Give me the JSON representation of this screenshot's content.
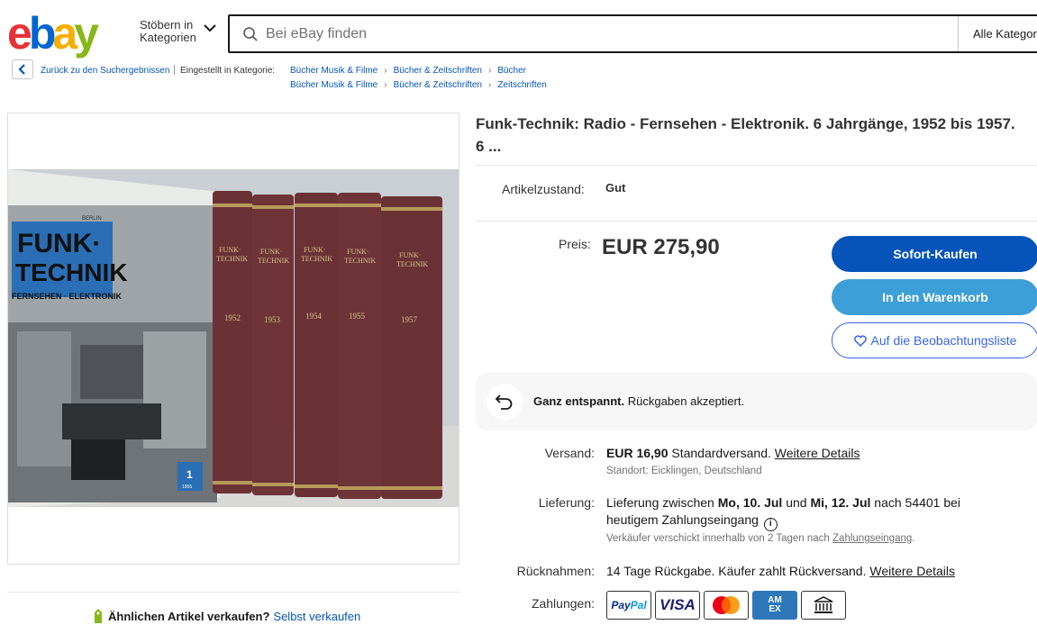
{
  "header": {
    "logo_letters": [
      "e",
      "b",
      "a",
      "y"
    ],
    "shop_by_category_line1": "Stöbern in",
    "shop_by_category_line2": "Kategorien",
    "search_placeholder": "Bei eBay finden",
    "category_select": "Alle Kategorien"
  },
  "breadcrumb": {
    "back_label": "Zurück zu den Suchergebnissen",
    "listed_in": "Eingestellt in Kategorie:",
    "path1": [
      "Bücher Musik & Filme",
      "Bücher & Zeitschriften",
      "Bücher"
    ],
    "path2": [
      "Bücher Musik & Filme",
      "Bücher & Zeitschriften",
      "Zeitschriften"
    ]
  },
  "gallery": {
    "alt": "Funk-Technik bound volumes",
    "cover_title_line1": "FUNK·",
    "cover_title_line2": "TECHNIK",
    "cover_subtitle": "FERNSEHEN · ELEKTRONIK",
    "cover_publisher": "BERLIN",
    "cover_issue": "1",
    "cover_year": "1955",
    "spine_title_line1": "FUNK·",
    "spine_title_line2": "TECHNIK",
    "volume_years": [
      "1952",
      "1953",
      "1954",
      "1955",
      "1957"
    ]
  },
  "sell_similar": {
    "label": "Ähnlichen Artikel verkaufen?",
    "link": "Selbst verkaufen"
  },
  "item": {
    "title": "Funk-Technik: Radio - Fernsehen - Elektronik. 6 Jahrgänge, 1952 bis 1957. 6 ...",
    "condition_label": "Artikelzustand:",
    "condition_value": "Gut",
    "price_label": "Preis:",
    "price": "EUR 275,90"
  },
  "buttons": {
    "buy_now": "Sofort-Kaufen",
    "add_to_cart": "In den Warenkorb",
    "watchlist": "Auf die Beobachtungsliste"
  },
  "returns_banner": {
    "bold": "Ganz entspannt.",
    "text": " Rückgaben akzeptiert."
  },
  "shipping": {
    "label": "Versand:",
    "cost": "EUR 16,90",
    "method": " Standardversand. ",
    "details_link": "Weitere Details",
    "location": "Standort: Eicklingen, Deutschland"
  },
  "delivery": {
    "label": "Lieferung:",
    "line1_pre": "Lieferung zwischen ",
    "date1": "Mo, 10. Jul",
    "mid": " und ",
    "date2": "Mi, 12. Jul",
    "line1_post": " nach 54401 bei",
    "line2": "heutigem Zahlungseingang",
    "note_pre": "Verkäufer verschickt innerhalb von 2 Tagen nach ",
    "note_link": "Zahlungseingang",
    "note_post": "."
  },
  "returns": {
    "label": "Rücknahmen:",
    "text": "14 Tage Rückgabe. Käufer zahlt Rückversand. ",
    "details_link": "Weitere Details"
  },
  "payments": {
    "label": "Zahlungen:",
    "methods": [
      "PayPal",
      "VISA",
      "Mastercard",
      "AMEX",
      "Bank transfer"
    ],
    "paypal_pay": "Pay",
    "paypal_pal": "Pal",
    "visa": "VISA",
    "amex_line1": "AM",
    "amex_line2": "EX"
  },
  "colors": {
    "buy_button": "#0654ba",
    "cart_button": "#3d9fd8",
    "link": "#0654ba",
    "watch_outline": "#3665f3"
  }
}
